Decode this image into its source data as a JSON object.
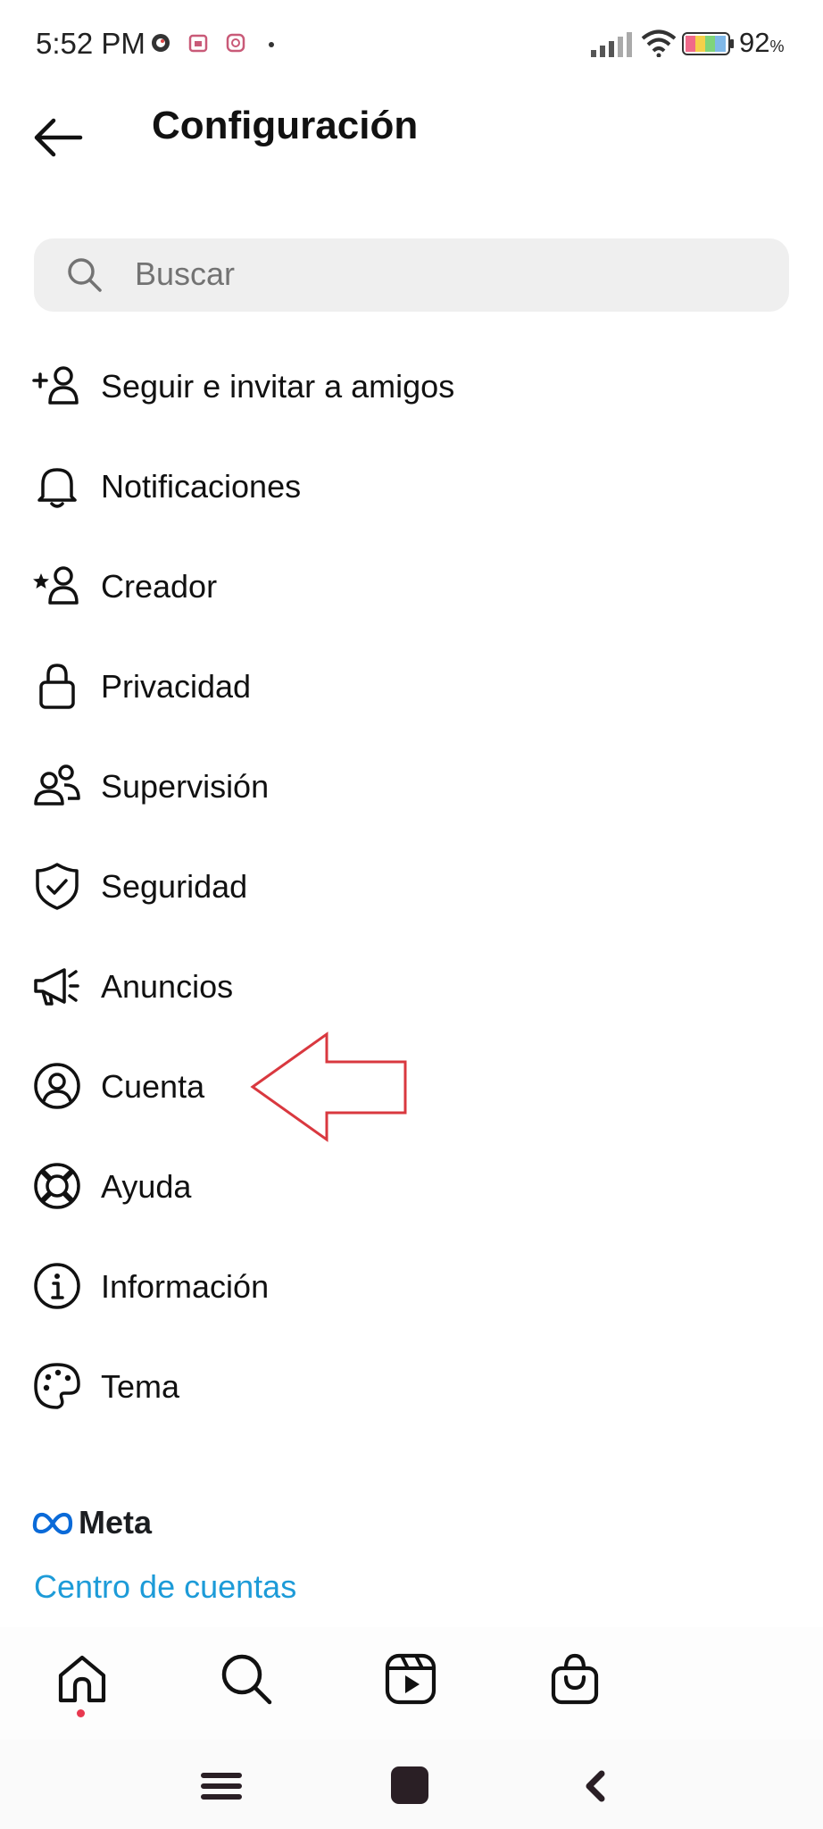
{
  "status_bar": {
    "time": "5:52 PM",
    "battery_percent": "92",
    "battery_unit": "%",
    "icons": [
      "app-notification-icon",
      "calendar-notification-icon",
      "app-notification-icon",
      "dot-icon",
      "signal-icon",
      "wifi-icon",
      "battery-icon"
    ]
  },
  "header": {
    "back_icon": "arrow-left-icon",
    "title": "Configuración"
  },
  "search": {
    "icon": "search-icon",
    "placeholder": "Buscar"
  },
  "menu": {
    "items": [
      {
        "label": "Seguir e invitar a amigos",
        "icon": "add-person-icon"
      },
      {
        "label": "Notificaciones",
        "icon": "bell-icon"
      },
      {
        "label": "Creador",
        "icon": "star-person-icon"
      },
      {
        "label": "Privacidad",
        "icon": "lock-icon"
      },
      {
        "label": "Supervisión",
        "icon": "people-icon"
      },
      {
        "label": "Seguridad",
        "icon": "shield-check-icon"
      },
      {
        "label": "Anuncios",
        "icon": "megaphone-icon"
      },
      {
        "label": "Cuenta",
        "icon": "account-circle-icon"
      },
      {
        "label": "Ayuda",
        "icon": "lifebuoy-icon"
      },
      {
        "label": "Información",
        "icon": "info-icon"
      },
      {
        "label": "Tema",
        "icon": "palette-icon"
      }
    ]
  },
  "footer": {
    "meta_word": "Meta",
    "accounts_center": "Centro de cuentas"
  },
  "bottom_nav": {
    "items": [
      "home-icon",
      "search-icon",
      "reels-icon",
      "shop-icon"
    ]
  },
  "system_nav": {
    "items": [
      "menu-icon",
      "home-square-icon",
      "back-chevron-icon"
    ]
  },
  "colors": {
    "link": "#1d9bd8",
    "annotation_arrow": "#d9383f",
    "notification_dot": "#e8384f"
  }
}
